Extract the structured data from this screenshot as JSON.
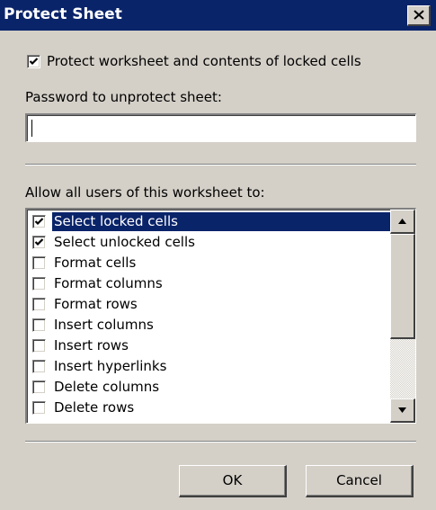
{
  "window": {
    "title": "Protect Sheet",
    "close_icon": "close-icon"
  },
  "protect_checkbox": {
    "checked": true,
    "label": "Protect worksheet and contents of locked cells"
  },
  "password": {
    "label": "Password to unprotect sheet:",
    "value": ""
  },
  "allow": {
    "label": "Allow all users of this worksheet to:",
    "items": [
      {
        "label": "Select locked cells",
        "checked": true,
        "selected": true
      },
      {
        "label": "Select unlocked cells",
        "checked": true,
        "selected": false
      },
      {
        "label": "Format cells",
        "checked": false,
        "selected": false
      },
      {
        "label": "Format columns",
        "checked": false,
        "selected": false
      },
      {
        "label": "Format rows",
        "checked": false,
        "selected": false
      },
      {
        "label": "Insert columns",
        "checked": false,
        "selected": false
      },
      {
        "label": "Insert rows",
        "checked": false,
        "selected": false
      },
      {
        "label": "Insert hyperlinks",
        "checked": false,
        "selected": false
      },
      {
        "label": "Delete columns",
        "checked": false,
        "selected": false
      },
      {
        "label": "Delete rows",
        "checked": false,
        "selected": false
      }
    ]
  },
  "buttons": {
    "ok": "OK",
    "cancel": "Cancel"
  },
  "colors": {
    "titlebar": "#0a246a",
    "selection": "#0a246a",
    "face": "#d4d0c8"
  }
}
